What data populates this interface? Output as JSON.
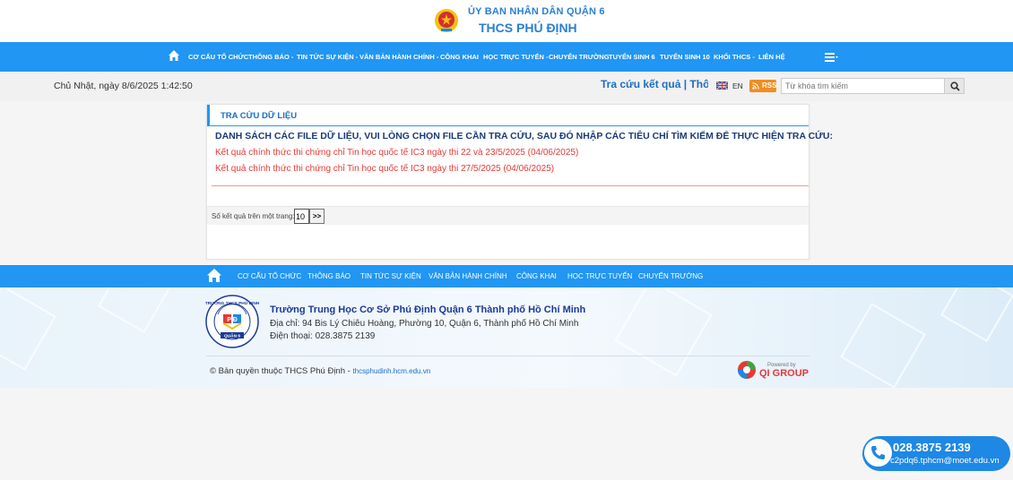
{
  "header": {
    "org": "ỦY BAN NHÂN DÂN QUẬN 6",
    "school": "THCS PHÚ ĐỊNH"
  },
  "nav": {
    "items": [
      "CƠ CẤU TỔ CHỨC",
      "THÔNG BÁO -",
      "TIN TỨC SỰ KIỆN -",
      "VĂN BẢN HÀNH CHÍNH -",
      "CÔNG KHAI",
      "HỌC TRỰC TUYẾN -",
      "CHUYỂN TRƯỜNG",
      "TUYỂN SINH 6",
      "TUYỂN SINH 10",
      "KHỐI THCS -",
      "LIÊN HỆ"
    ],
    "menu_icon": "hamburger-icon"
  },
  "subbar": {
    "datetime": "Chủ Nhật, ngày 8/6/2025 1:42:50",
    "marquee": "Tra cứu kết quả  |  Thông",
    "language": "EN",
    "rss": "RSS",
    "search_placeholder": "Từ khóa tìm kiếm"
  },
  "panel": {
    "title": "TRA CỨU DỮ LIỆU",
    "intro": "DANH SÁCH CÁC FILE DỮ LIỆU, VUI LÒNG CHỌN FILE CẦN TRA CỨU, SAU ĐÓ NHẬP CÁC TIÊU CHÍ TÌM KIẾM ĐỂ THỰC HIỆN TRA CỨU:",
    "files": [
      "Kết quả chính thức thi chứng chỉ Tin học quốc tế IC3 ngày thi 22 và 23/5/2025 (04/06/2025)",
      "Kết quả chính thức thi chứng chỉ Tin học quốc tế IC3 ngày thi 27/5/2025 (04/06/2025)"
    ],
    "pager_label": "Số kết quả trên một trang:",
    "pager_value": "10",
    "pager_next": ">>"
  },
  "footnav": {
    "items": [
      "CƠ CẤU TỔ CHỨC",
      "THÔNG BÁO",
      "TIN TỨC SỰ KIỆN",
      "VĂN BẢN HÀNH CHÍNH",
      "CÔNG KHAI",
      "HỌC TRỰC TUYẾN",
      "CHUYỂN TRƯỜNG"
    ]
  },
  "footer": {
    "name": "Trường Trung Học Cơ Sở Phú Định Quận 6 Thành phố Hồ Chí Minh",
    "address": "Địa chỉ: 94 Bis Lý Chiêu Hoàng, Phường 10, Quận 6, Thành phố Hồ Chí Minh",
    "phone": "Điện thoại: 028.3875 2139",
    "copyright": "© Bản quyền thuộc THCS Phú Định - ",
    "site": "thcsphudinh.hcm.edu.vn",
    "powered_by": "Powered by",
    "vendor": "QI GROUP",
    "logo_text_top": "TRƯỜNG THCS PHÚ ĐỊNH",
    "logo_letters": "P Đ",
    "logo_text_bottom": "QUẬN 6"
  },
  "hotline": {
    "phone": "028.3875 2139",
    "email": "c2pdq6.tphcm@moet.edu.vn"
  },
  "colors": {
    "primary": "#2196f3",
    "link_red": "#e53935",
    "title_blue": "#1b6fc2"
  }
}
